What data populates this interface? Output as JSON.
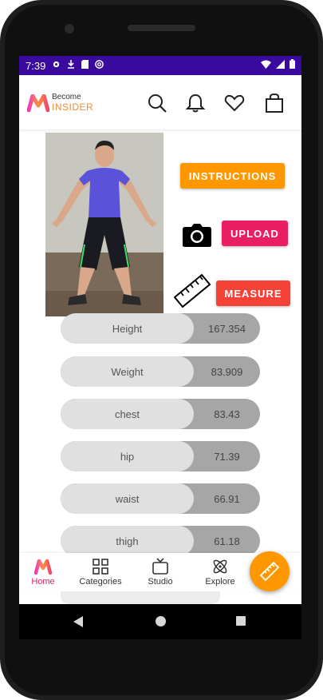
{
  "status_bar": {
    "time": "7:39",
    "icons": [
      "gear-icon",
      "download-icon",
      "sd-card-icon",
      "at-icon"
    ],
    "right_icons": [
      "wifi-icon",
      "signal-icon",
      "battery-icon"
    ],
    "bg_color": "#3a0a9e"
  },
  "header": {
    "logo_line1": "Become",
    "logo_line2": "INSIDER",
    "icons": [
      "search-icon",
      "bell-icon",
      "heart-icon",
      "bag-icon"
    ]
  },
  "actions": {
    "instructions_label": "INSTRUCTIONS",
    "upload_label": "UPLOAD",
    "measure_label": "MEASURE",
    "instructions_color": "#ff9800",
    "upload_color": "#e91e63",
    "measure_color": "#f44336"
  },
  "metrics": [
    {
      "label": "Height",
      "value": "167.354"
    },
    {
      "label": "Weight",
      "value": "83.909"
    },
    {
      "label": "chest",
      "value": "83.43"
    },
    {
      "label": "hip",
      "value": "71.39"
    },
    {
      "label": "waist",
      "value": "66.91"
    },
    {
      "label": "thigh",
      "value": "61.18"
    }
  ],
  "bottom_nav": {
    "items": [
      {
        "label": "Home",
        "icon": "myntra-logo-icon",
        "active": true
      },
      {
        "label": "Categories",
        "icon": "grid-icon",
        "active": false
      },
      {
        "label": "Studio",
        "icon": "tv-icon",
        "active": false
      },
      {
        "label": "Explore",
        "icon": "atom-icon",
        "active": false
      }
    ],
    "fab_icon": "ruler-icon",
    "active_color": "#e91e63"
  }
}
